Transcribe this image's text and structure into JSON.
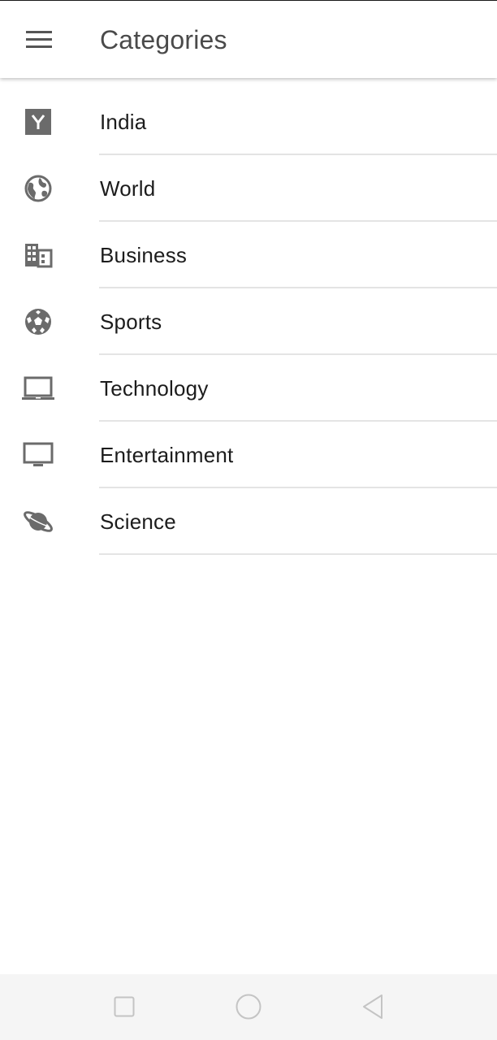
{
  "appbar": {
    "title": "Categories",
    "menu_icon": "hamburger-menu-icon"
  },
  "categories": [
    {
      "label": "India",
      "icon": "y-logo-icon"
    },
    {
      "label": "World",
      "icon": "globe-icon"
    },
    {
      "label": "Business",
      "icon": "building-icon"
    },
    {
      "label": "Sports",
      "icon": "soccer-ball-icon"
    },
    {
      "label": "Technology",
      "icon": "laptop-icon"
    },
    {
      "label": "Entertainment",
      "icon": "tv-icon"
    },
    {
      "label": "Science",
      "icon": "planet-icon"
    }
  ],
  "navbar": {
    "recents_icon": "square-recents-icon",
    "home_icon": "circle-home-icon",
    "back_icon": "triangle-back-icon"
  },
  "colors": {
    "icon": "#6b6b6b",
    "title": "#4a4a4a",
    "text": "#1c1c1c",
    "divider": "#e4e4e4",
    "navbar_bg": "#f5f5f5",
    "navbar_icon": "#c4c4c4"
  }
}
